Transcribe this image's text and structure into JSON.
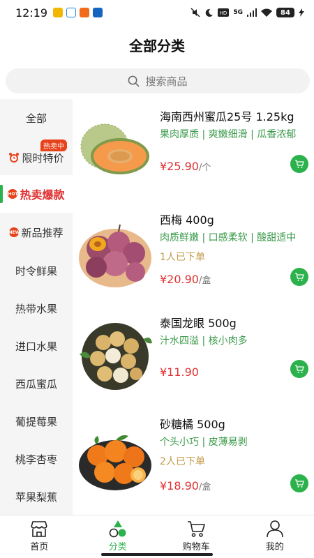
{
  "status_bar": {
    "time": "12:19",
    "network": "5G",
    "battery": "84",
    "icons": [
      "app-icon",
      "app-icon",
      "app-icon",
      "app-icon",
      "mute-icon",
      "moon-icon",
      "hd-icon",
      "signal-icon",
      "wifi-icon",
      "charging-icon"
    ]
  },
  "header": {
    "title": "全部分类"
  },
  "search": {
    "placeholder": "搜索商品"
  },
  "sidebar": {
    "items": [
      {
        "label": "全部"
      },
      {
        "label": "限时特价",
        "tag": "热卖中"
      },
      {
        "label": "热卖爆款",
        "badge": "HOT",
        "active": true
      },
      {
        "label": "新品推荐",
        "badge": "NEW"
      },
      {
        "label": "时令鲜果"
      },
      {
        "label": "热带水果"
      },
      {
        "label": "进口水果"
      },
      {
        "label": "西瓜蜜瓜"
      },
      {
        "label": "葡提莓果"
      },
      {
        "label": "桃李杏枣"
      },
      {
        "label": "苹果梨蕉"
      }
    ]
  },
  "products": [
    {
      "name": "海南西州蜜瓜25号 1.25kg",
      "tags": "果肉厚质 | 爽嫩细滑 | 瓜香浓郁",
      "sold": "",
      "price": "¥25.90",
      "unit": "/个",
      "image": "melon"
    },
    {
      "name": "西梅 400g",
      "tags": "肉质鲜嫩 | 口感柔软 | 酸甜适中",
      "sold": "1人已下单",
      "price": "¥20.90",
      "unit": "/盒",
      "image": "plum"
    },
    {
      "name": "泰国龙眼 500g",
      "tags": "汁水四溢 | 核小肉多",
      "sold": "",
      "price": "¥11.90",
      "unit": "",
      "image": "longan"
    },
    {
      "name": "砂糖橘 500g",
      "tags": "个头小巧 | 皮薄易剥",
      "sold": "2人已下单",
      "price": "¥18.90",
      "unit": "/盒",
      "image": "tangerine"
    }
  ],
  "bottom_nav": [
    {
      "label": "首页",
      "icon": "store-icon"
    },
    {
      "label": "分类",
      "icon": "category-icon",
      "active": true
    },
    {
      "label": "购物车",
      "icon": "cart-icon"
    },
    {
      "label": "我的",
      "icon": "user-icon"
    }
  ],
  "colors": {
    "accent": "#2bb24c",
    "price": "#e03131",
    "tag_text": "#3a9a4a",
    "sold_text": "#c39a4a",
    "hot": "#e8421b"
  }
}
